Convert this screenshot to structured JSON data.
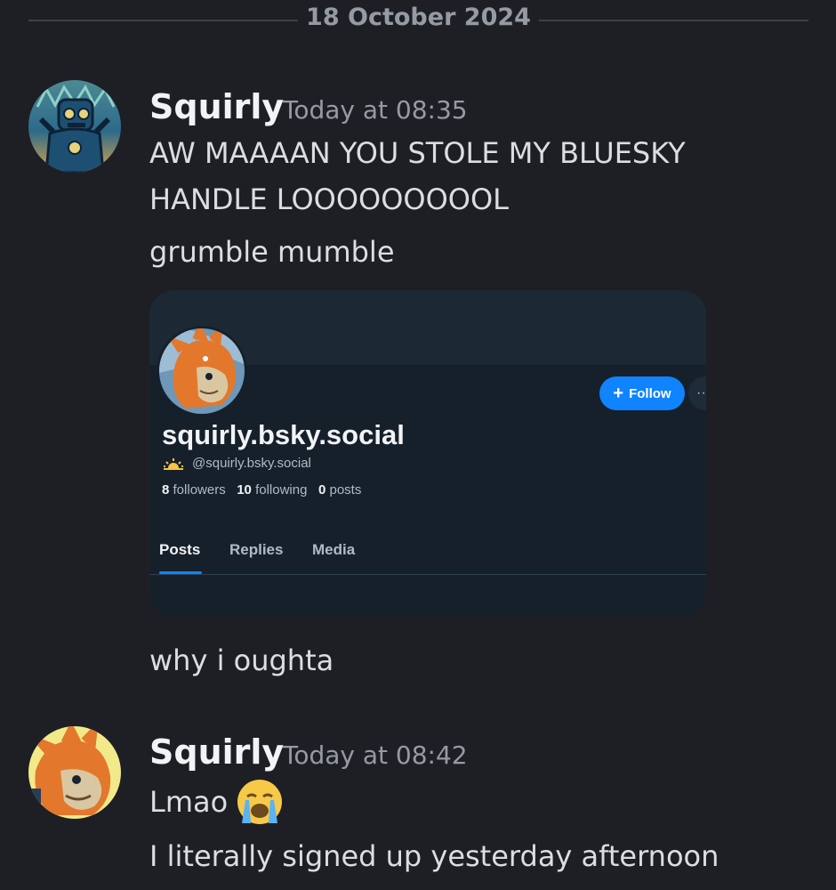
{
  "date_divider": "18 October 2024",
  "messages": [
    {
      "author": "Squirly",
      "timestamp": "Today at 08:35",
      "lines": [
        "AW MAAAAN YOU STOLE MY BLUESKY",
        "HANDLE LOOOOOOOOOL"
      ],
      "line2": "grumble mumble",
      "embed": {
        "display_name": "squirly.bsky.social",
        "handle": "@squirly.bsky.social",
        "follow_label": "Follow",
        "more_label": "··",
        "followers_count": "8",
        "followers_label": "followers",
        "following_count": "10",
        "following_label": "following",
        "posts_count": "0",
        "posts_label": "posts",
        "tabs": [
          "Posts",
          "Replies",
          "Media"
        ],
        "active_tab": "Posts"
      },
      "after_embed": "why i oughta"
    },
    {
      "author": "Squirly",
      "timestamp": "Today at 08:42",
      "text": "Lmao",
      "emoji": "loudly-crying-face",
      "line2": "I literally signed up yesterday afternoon"
    }
  ],
  "colors": {
    "background": "#1e1f24",
    "author": "#f2f3f5",
    "timestamp": "#949ba4",
    "bsky_blue": "#1083fe"
  }
}
